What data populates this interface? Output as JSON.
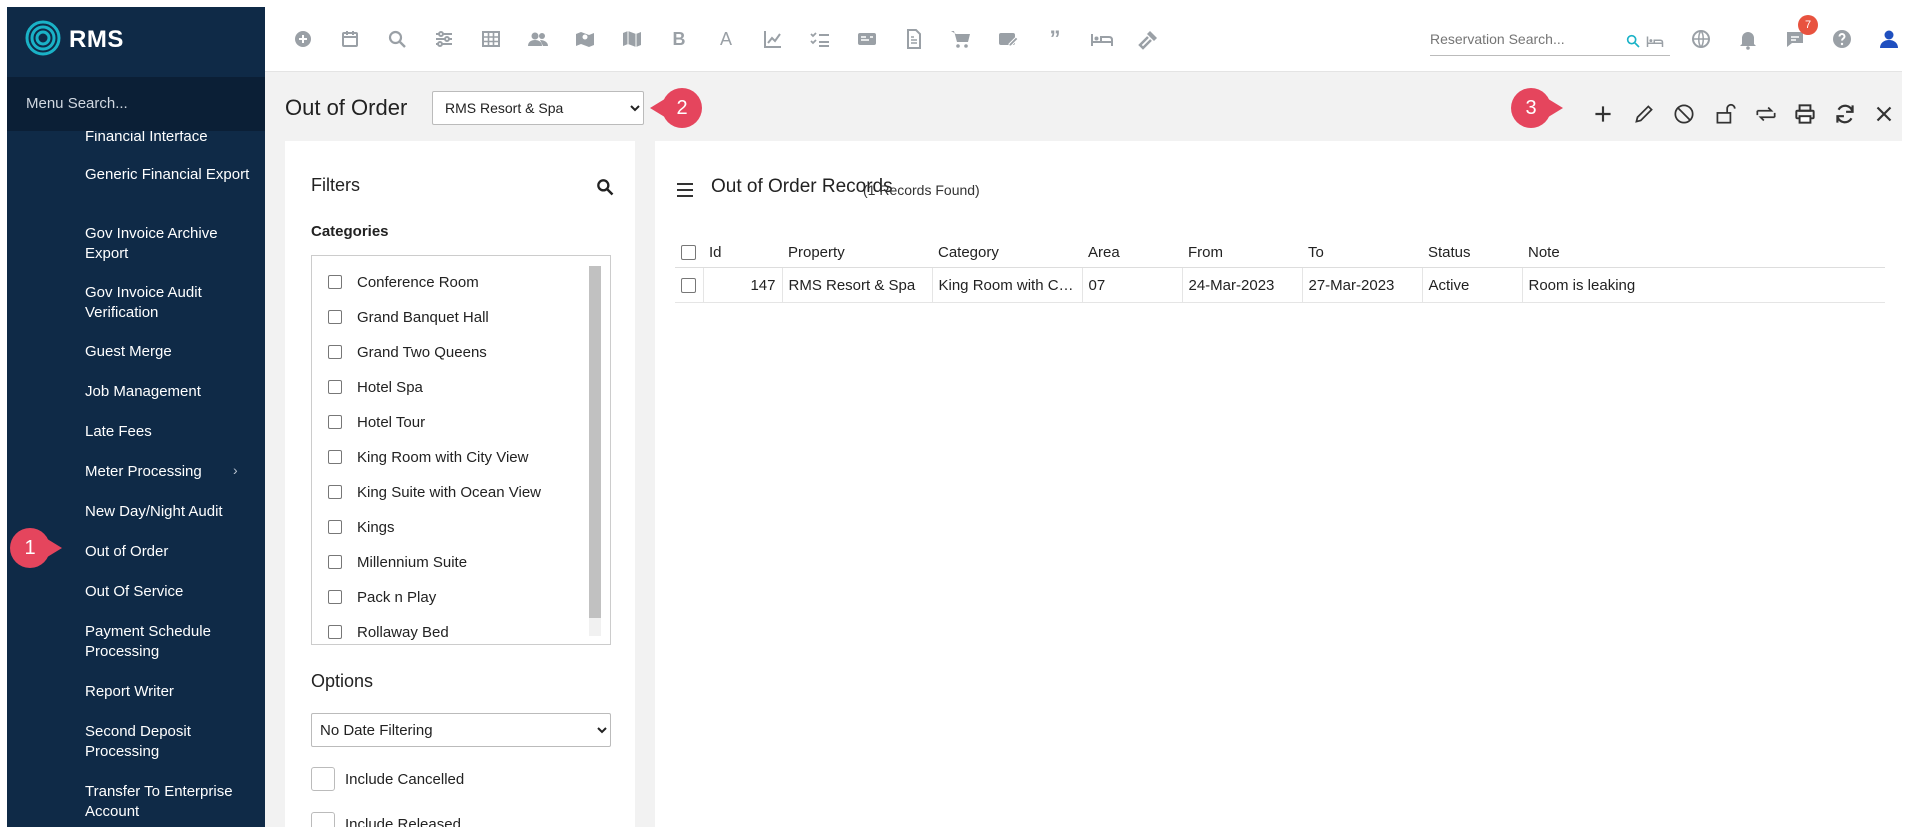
{
  "app": {
    "logo_text": "RMS"
  },
  "sidebar": {
    "search_placeholder": "Menu Search...",
    "items": [
      {
        "label": "Financial Interface"
      },
      {
        "label": "Generic Financial Export"
      },
      {
        "label": "Gov Invoice Archive Export"
      },
      {
        "label": "Gov Invoice Audit Verification"
      },
      {
        "label": "Guest Merge"
      },
      {
        "label": "Job Management"
      },
      {
        "label": "Late Fees"
      },
      {
        "label": "Meter Processing",
        "has_submenu": true
      },
      {
        "label": "New Day/Night Audit"
      },
      {
        "label": "Out of Order",
        "active": true
      },
      {
        "label": "Out Of Service"
      },
      {
        "label": "Payment Schedule Processing"
      },
      {
        "label": "Report Writer"
      },
      {
        "label": "Second Deposit Processing"
      },
      {
        "label": "Transfer To Enterprise Account"
      }
    ]
  },
  "topbar": {
    "icons": [
      "plus-circle-icon",
      "calendar-icon",
      "search-icon",
      "sliders-icon",
      "grid-icon",
      "people-icon",
      "map-icon",
      "book-map-icon",
      "bold-b-icon",
      "font-a-icon",
      "chart-line-icon",
      "checklist-icon",
      "card-icon",
      "document-icon",
      "cart-icon",
      "edit-card-icon",
      "quote-icon",
      "bed-icon",
      "hammer-icon"
    ],
    "reservation_search_placeholder": "Reservation Search...",
    "right_icons": [
      "globe-icon",
      "bell-icon",
      "chat-icon",
      "help-icon",
      "user-icon"
    ],
    "notification_count": "7"
  },
  "page": {
    "title": "Out of Order",
    "property_options": [
      "RMS Resort & Spa"
    ],
    "property_selected": "RMS Resort & Spa"
  },
  "markers": {
    "m1": "1",
    "m2": "2",
    "m3": "3"
  },
  "actions": [
    "add-icon",
    "edit-icon",
    "cancel-icon",
    "unlock-icon",
    "transfer-icon",
    "print-icon",
    "refresh-icon",
    "close-icon"
  ],
  "filters": {
    "title": "Filters",
    "categories_label": "Categories",
    "categories": [
      "Conference Room",
      "Grand Banquet Hall",
      "Grand Two Queens",
      "Hotel Spa",
      "Hotel Tour",
      "King Room with City View",
      "King Suite with Ocean View",
      "Kings",
      "Millennium Suite",
      "Pack n Play",
      "Rollaway Bed"
    ],
    "options_label": "Options",
    "date_filter_selected": "No Date Filtering",
    "include_cancelled": "Include Cancelled",
    "include_released": "Include Released"
  },
  "records": {
    "title": "Out of Order Records",
    "count": "(1 Records Found)",
    "columns": [
      "Id",
      "Property",
      "Category",
      "Area",
      "From",
      "To",
      "Status",
      "Note"
    ],
    "rows": [
      {
        "id": "147",
        "property": "RMS Resort & Spa",
        "category": "King Room with Cit...",
        "area": "07",
        "from": "24-Mar-2023",
        "to": "27-Mar-2023",
        "status": "Active",
        "note": "Room is leaking"
      }
    ]
  },
  "colors": {
    "sidebar_bg": "#0f2a47",
    "accent": "#1ab2c7",
    "marker": "#e5455d",
    "badge": "#e8533f",
    "user_icon": "#1f4fbf"
  }
}
